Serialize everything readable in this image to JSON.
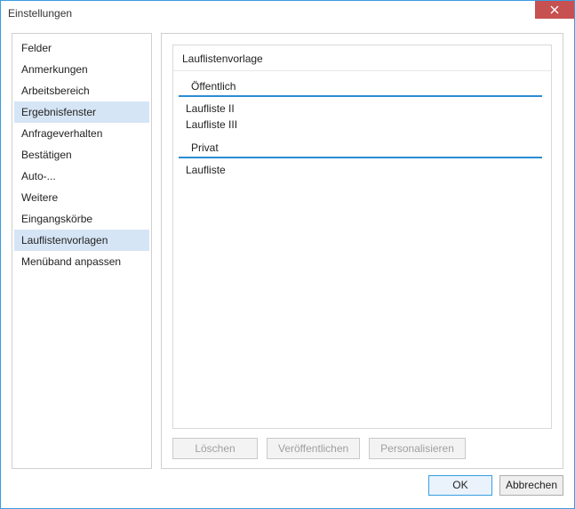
{
  "window": {
    "title": "Einstellungen"
  },
  "sidebar": {
    "items": [
      {
        "label": "Felder",
        "selected": false
      },
      {
        "label": "Anmerkungen",
        "selected": false
      },
      {
        "label": "Arbeitsbereich",
        "selected": false
      },
      {
        "label": "Ergebnisfenster",
        "selected": true
      },
      {
        "label": "Anfrageverhalten",
        "selected": false
      },
      {
        "label": "Bestätigen",
        "selected": false
      },
      {
        "label": "Auto-...",
        "selected": false
      },
      {
        "label": "Weitere",
        "selected": false
      },
      {
        "label": "Eingangskörbe",
        "selected": false
      },
      {
        "label": "Lauflistenvorlagen",
        "selected": true
      },
      {
        "label": "Menüband anpassen",
        "selected": false
      }
    ]
  },
  "main": {
    "list_header": "Lauflistenvorlage",
    "sections": [
      {
        "header": "Öffentlich",
        "items": [
          "Laufliste II",
          "Laufliste III"
        ]
      },
      {
        "header": "Privat",
        "items": [
          "Laufliste"
        ]
      }
    ],
    "actions": {
      "delete": "Löschen",
      "publish": "Veröffentlichen",
      "personalize": "Personalisieren"
    }
  },
  "footer": {
    "ok": "OK",
    "cancel": "Abbrechen"
  }
}
